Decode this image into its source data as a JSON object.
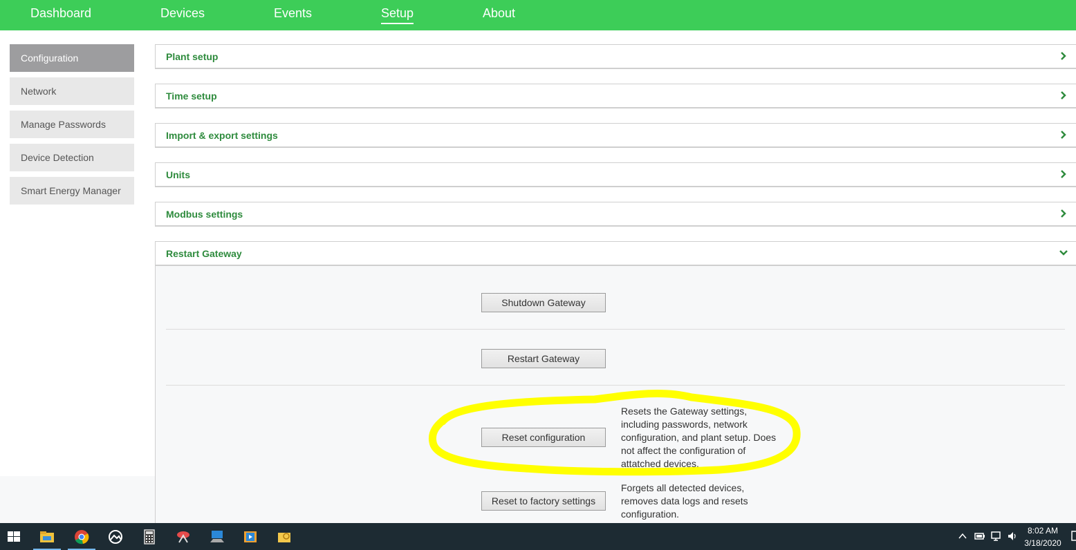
{
  "nav": {
    "items": [
      "Dashboard",
      "Devices",
      "Events",
      "Setup",
      "About"
    ],
    "active": "Setup"
  },
  "sidebar": {
    "items": [
      "Configuration",
      "Network",
      "Manage Passwords",
      "Device Detection",
      "Smart Energy Manager"
    ],
    "active": "Configuration"
  },
  "panels": {
    "plant_setup": "Plant setup",
    "time_setup": "Time setup",
    "import_export": "Import & export settings",
    "units": "Units",
    "modbus": "Modbus settings",
    "restart_gateway": "Restart Gateway"
  },
  "restart_section": {
    "shutdown_label": "Shutdown Gateway",
    "restart_label": "Restart Gateway",
    "reset_config_label": "Reset configuration",
    "reset_config_desc": "Resets the Gateway settings, including passwords, network configuration, and plant setup. Does not affect the configuration of attatched devices.",
    "factory_label": "Reset to factory settings",
    "factory_desc": "Forgets all detected devices, removes data logs and resets configuration."
  },
  "taskbar": {
    "time": "8:02 AM",
    "date": "3/18/2020"
  },
  "colors": {
    "brand_green": "#3dcd58",
    "title_green": "#2e8b3d",
    "highlight": "#ffff00"
  }
}
